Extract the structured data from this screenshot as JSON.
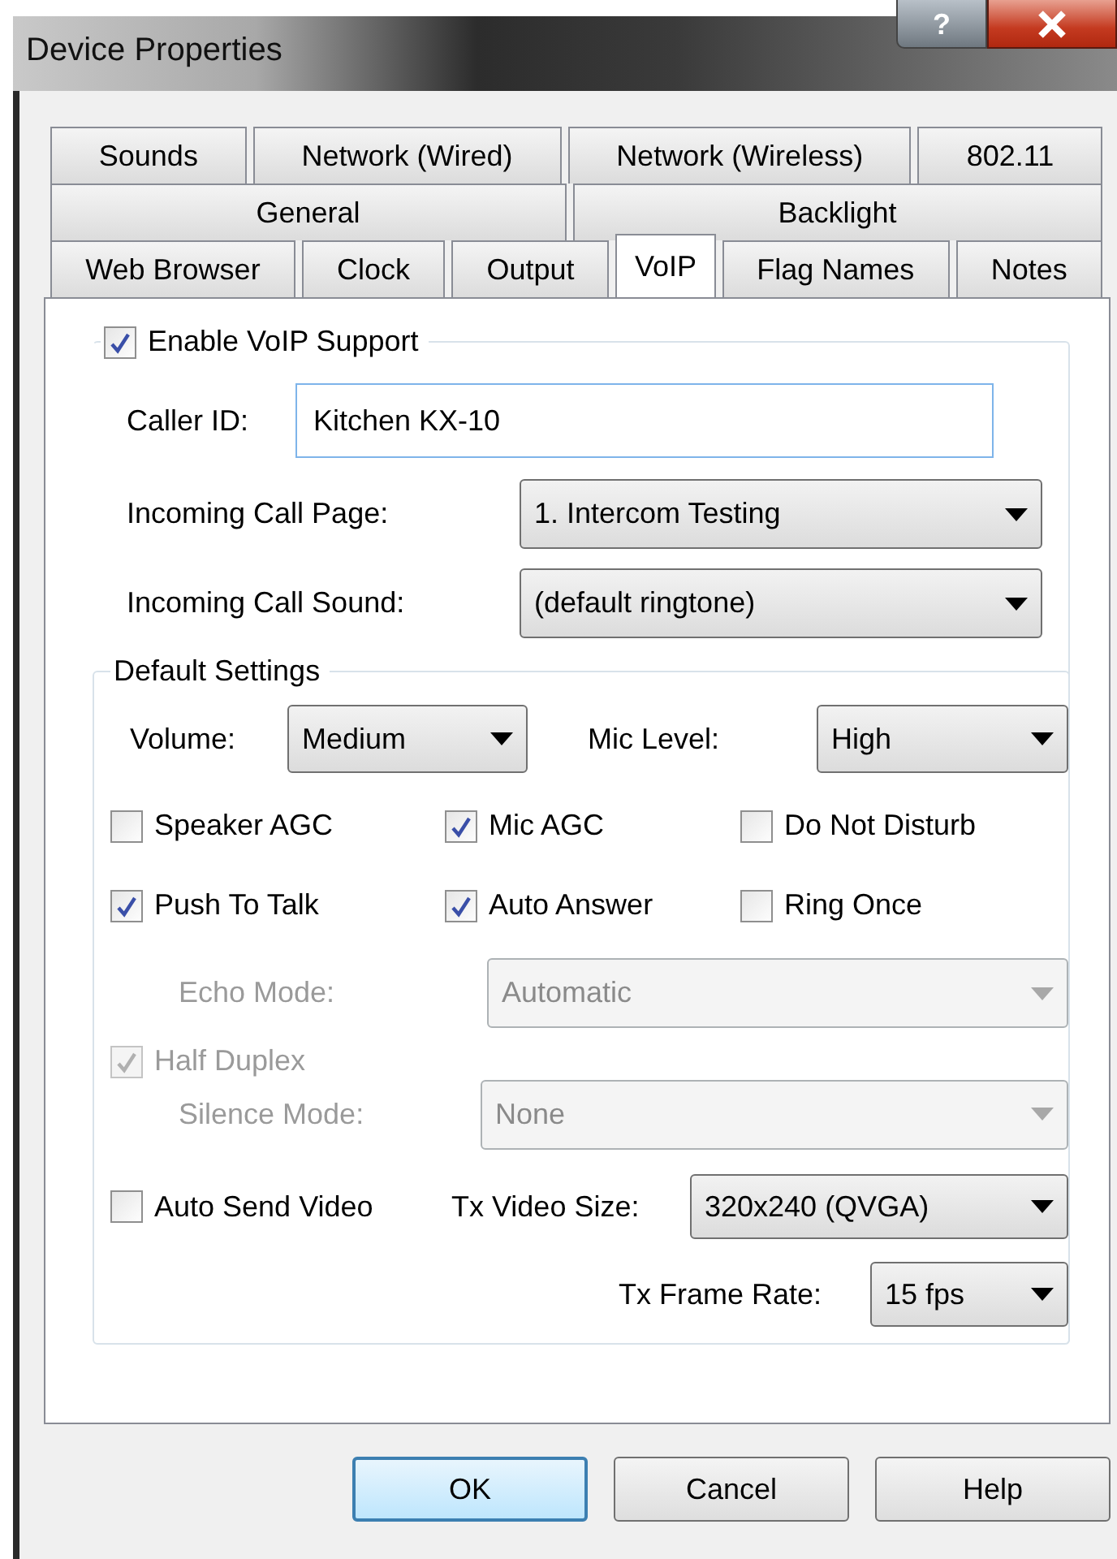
{
  "window": {
    "title": "Device Properties",
    "help_button": "?"
  },
  "tabs": [
    [
      {
        "label": "Sounds",
        "selected": false
      },
      {
        "label": "Network (Wired)",
        "selected": false
      },
      {
        "label": "Network (Wireless)",
        "selected": false
      },
      {
        "label": "802.11",
        "selected": false
      }
    ],
    [
      {
        "label": "General",
        "selected": false
      },
      {
        "label": "Backlight",
        "selected": false
      }
    ],
    [
      {
        "label": "Web Browser",
        "selected": false
      },
      {
        "label": "Clock",
        "selected": false
      },
      {
        "label": "Output",
        "selected": false
      },
      {
        "label": "VoIP",
        "selected": true
      },
      {
        "label": "Flag Names",
        "selected": false
      },
      {
        "label": "Notes",
        "selected": false
      }
    ]
  ],
  "voip": {
    "enable": {
      "label": "Enable VoIP Support",
      "checked": true
    },
    "caller_id": {
      "label": "Caller ID:",
      "value": "Kitchen KX-10"
    },
    "incoming_call_page": {
      "label": "Incoming Call Page:",
      "value": "1. Intercom Testing"
    },
    "incoming_call_sound": {
      "label": "Incoming Call Sound:",
      "value": "(default ringtone)"
    }
  },
  "default_settings": {
    "title": "Default Settings",
    "volume": {
      "label": "Volume:",
      "value": "Medium"
    },
    "mic_level": {
      "label": "Mic Level:",
      "value": "High"
    },
    "checkboxes": [
      {
        "label": "Speaker AGC",
        "checked": false
      },
      {
        "label": "Mic AGC",
        "checked": true
      },
      {
        "label": "Do Not Disturb",
        "checked": false
      },
      {
        "label": "Push To Talk",
        "checked": true
      },
      {
        "label": "Auto Answer",
        "checked": true
      },
      {
        "label": "Ring Once",
        "checked": false
      }
    ],
    "echo_mode": {
      "label": "Echo Mode:",
      "value": "Automatic",
      "disabled": true
    },
    "half_duplex": {
      "label": "Half Duplex",
      "checked": true,
      "disabled": true
    },
    "silence_mode": {
      "label": "Silence Mode:",
      "value": "None",
      "disabled": true
    },
    "auto_send_video": {
      "label": "Auto Send Video",
      "checked": false
    },
    "tx_video_size": {
      "label": "Tx Video Size:",
      "value": "320x240 (QVGA)"
    },
    "tx_frame_rate": {
      "label": "Tx Frame Rate:",
      "value": "15 fps"
    }
  },
  "buttons": [
    {
      "label": "OK",
      "default": true
    },
    {
      "label": "Cancel",
      "default": false
    },
    {
      "label": "Help",
      "default": false
    }
  ]
}
